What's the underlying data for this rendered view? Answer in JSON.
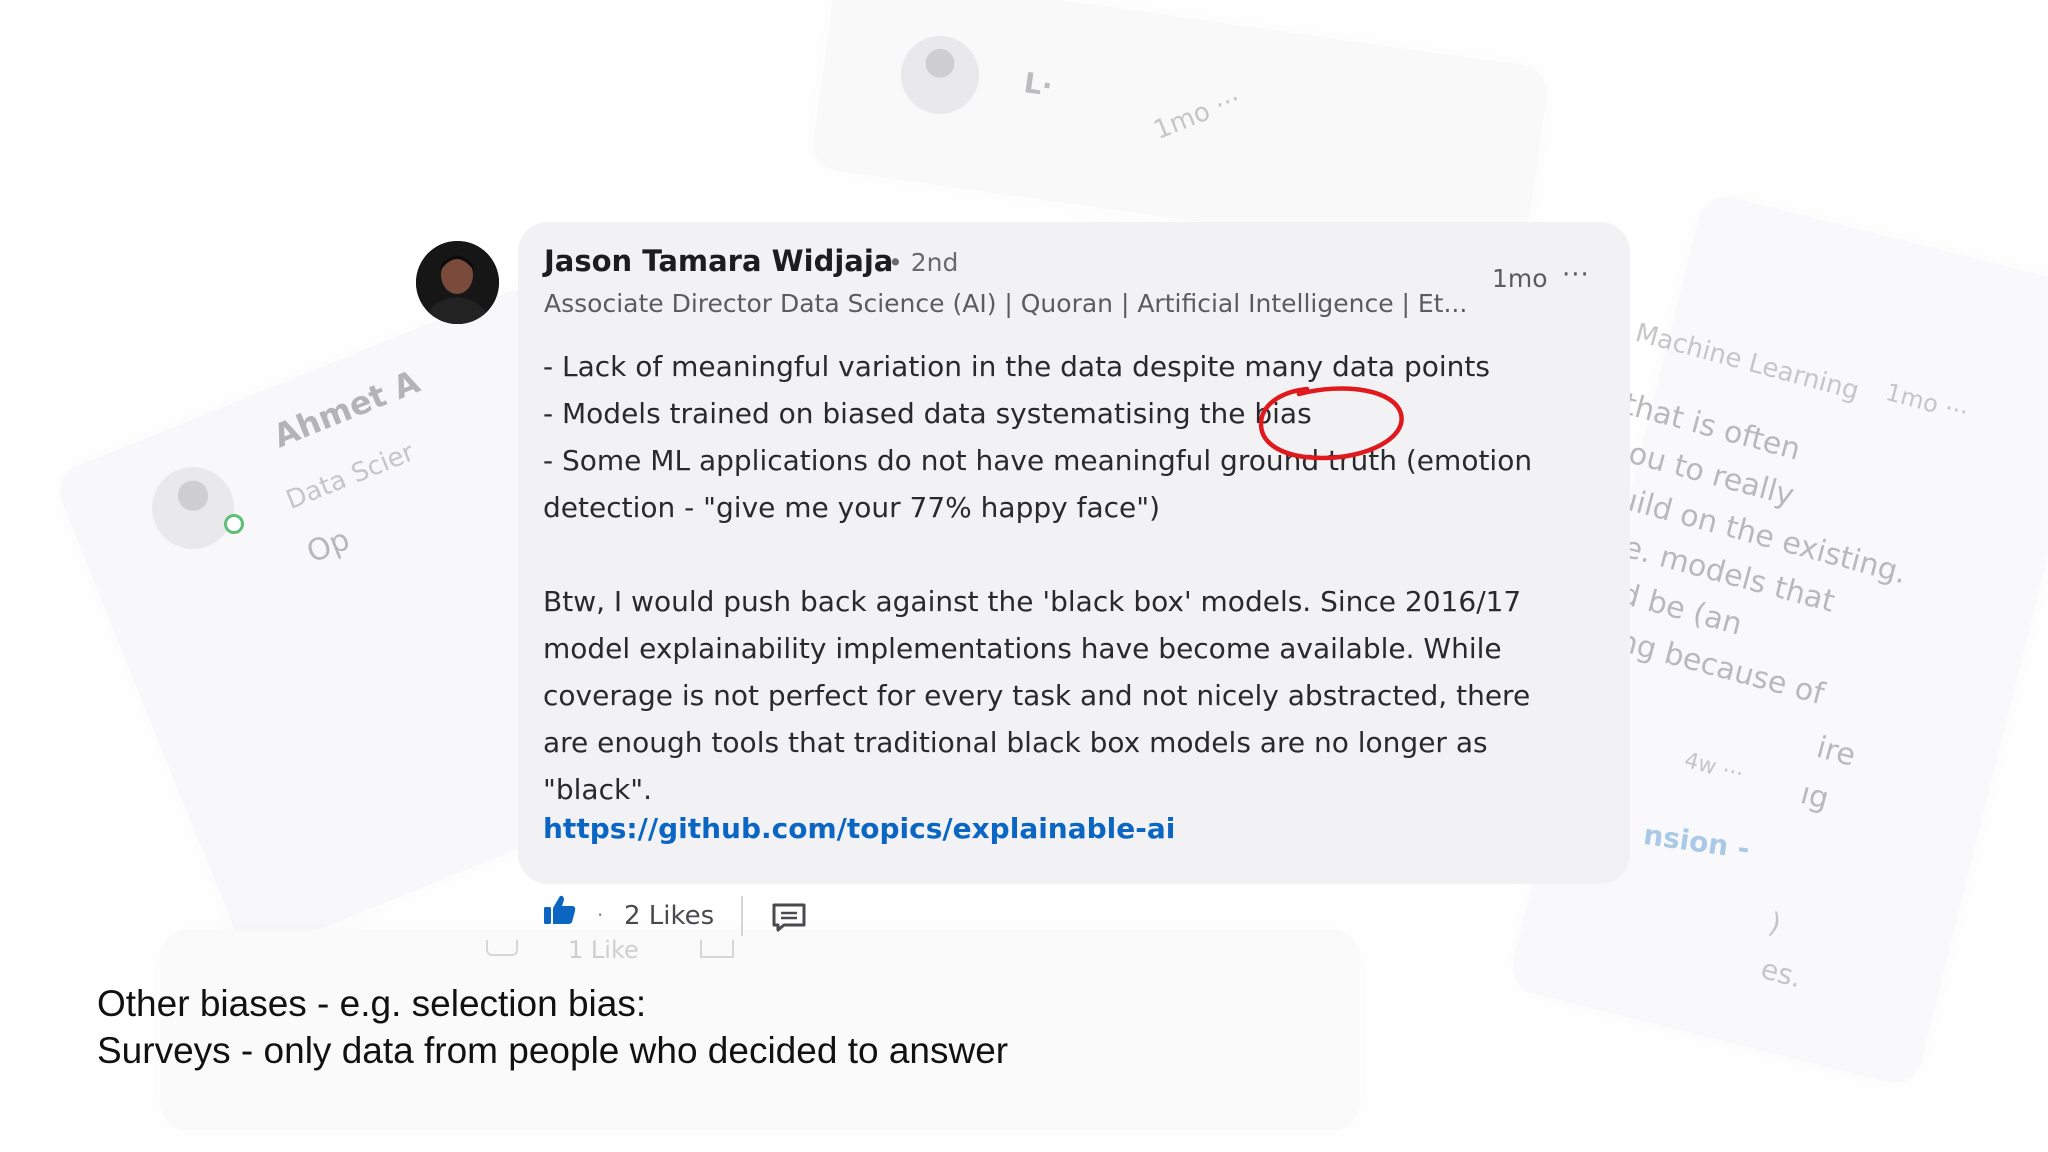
{
  "background_cards": {
    "top_card": {
      "name_initial": "L·",
      "time": "1mo ···"
    },
    "left_card": {
      "name": "Ahmet A",
      "title": "Data Scier",
      "snippet": "Op"
    },
    "right_card": {
      "header": "Machine Learning",
      "time": "1mo ···",
      "lines": [
        "that is often",
        "you to really",
        "build on the existing.",
        ". i.e. models that",
        "ould be (an",
        "orking because of",
        "ire",
        "ıg"
      ],
      "reply_time": "4w ···",
      "link_fragment": "nsion -",
      "tail_lines": [
        ")",
        "es."
      ]
    },
    "under_bar": {
      "likes": "1 Like"
    }
  },
  "post": {
    "author_name": "Jason Tamara Widjaja",
    "degree": "• 2nd",
    "author_title": "Associate Director Data Science (AI) | Quoran | Artificial Intelligence | Et...",
    "time": "1mo",
    "more_icon": "···",
    "body": "- Lack of meaningful variation in the data despite many data points\n- Models trained on biased data systematising the bias\n- Some ML applications do not have meaningful ground truth (emotion\ndetection - \"give me your 77% happy face\")\n\nBtw, I would push back against the 'black box' models. Since 2016/17\nmodel explainability implementations have become available. While\ncoverage is not perfect for every task and not nicely abstracted, there\nare enough tools that traditional black box models are no longer as\n\"black\".",
    "link": "https://github.com/topics/explainable-ai",
    "highlight_color": "#e0191e",
    "link_color": "#0a66c2"
  },
  "reactions": {
    "separator": "·",
    "likes": "2 Likes",
    "like_icon_color": "#0a66c2"
  },
  "caption": {
    "line1": "Other biases - e.g. selection bias:",
    "line2": "Surveys - only data from people who decided to answer"
  }
}
